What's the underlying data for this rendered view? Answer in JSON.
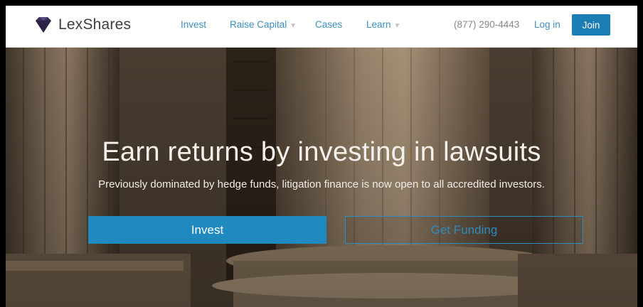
{
  "nav": {
    "brand": "LexShares",
    "logo_icon": "diamond-icon",
    "items": [
      {
        "label": "Invest",
        "dropdown": false
      },
      {
        "label": "Raise Capital",
        "dropdown": true
      },
      {
        "label": "Cases",
        "dropdown": false
      },
      {
        "label": "Learn",
        "dropdown": true
      }
    ],
    "phone": "(877) 290-4443",
    "login": "Log in",
    "join": "Join"
  },
  "hero": {
    "headline": "Earn returns by investing in lawsuits",
    "subline": "Previously dominated by hedge funds, litigation finance is now open to all accredited investors.",
    "primary_button": "Invest",
    "secondary_button": "Get Funding"
  },
  "colors": {
    "accent": "#1b7fb5",
    "link": "#3d8fc4",
    "brand_purple": "#3b2f56"
  }
}
